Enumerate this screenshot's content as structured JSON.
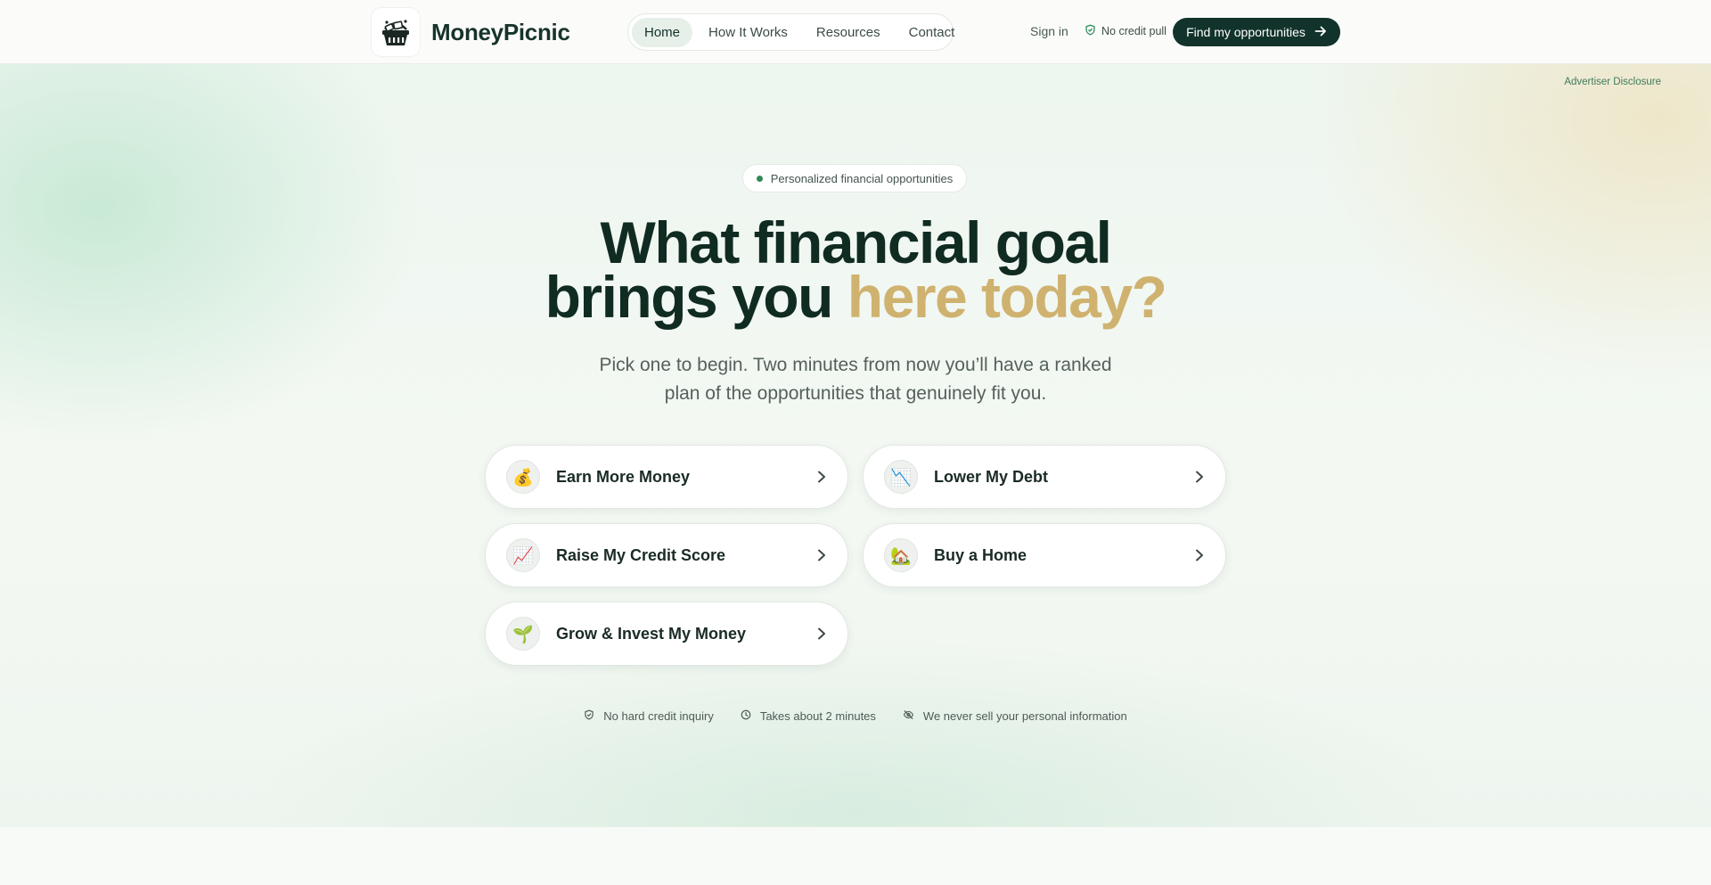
{
  "brand": {
    "name": "MoneyPicnic",
    "logo_icon": "picnic-basket-icon"
  },
  "nav": {
    "items": [
      {
        "label": "Home",
        "active": true
      },
      {
        "label": "How It Works",
        "active": false
      },
      {
        "label": "Resources",
        "active": false
      },
      {
        "label": "Contact",
        "active": false
      }
    ]
  },
  "header": {
    "sign_in": "Sign in",
    "no_credit_pull": "No credit pull",
    "cta_label": "Find my opportunities"
  },
  "hero": {
    "advertiser_disclosure": "Advertiser Disclosure",
    "pill": "Personalized financial opportunities",
    "headline_line1": "What financial goal",
    "headline_line2_main": "brings you",
    "headline_line2_accent": "here today?",
    "subtitle": "Pick one to begin. Two minutes from now you’ll have a ranked plan of the opportunities that genuinely fit you."
  },
  "goals": [
    {
      "label": "Earn More Money",
      "icon": "money-bag-icon",
      "glyph": "💰"
    },
    {
      "label": "Lower My Debt",
      "icon": "chart-decreasing-icon",
      "glyph": "📉"
    },
    {
      "label": "Raise My Credit Score",
      "icon": "chart-increasing-icon",
      "glyph": "📈"
    },
    {
      "label": "Buy a Home",
      "icon": "house-icon",
      "glyph": "🏡"
    },
    {
      "label": "Grow & Invest My Money",
      "icon": "seedling-icon",
      "glyph": "🌱"
    }
  ],
  "trust": [
    {
      "label": "No hard credit inquiry",
      "icon": "shield-check-icon"
    },
    {
      "label": "Takes about 2 minutes",
      "icon": "clock-icon"
    },
    {
      "label": "We never sell your personal information",
      "icon": "eye-off-icon"
    }
  ],
  "colors": {
    "primary_dark": "#12332b",
    "accent_gold": "#cfb26f",
    "brand_green": "#2f8a5a"
  }
}
